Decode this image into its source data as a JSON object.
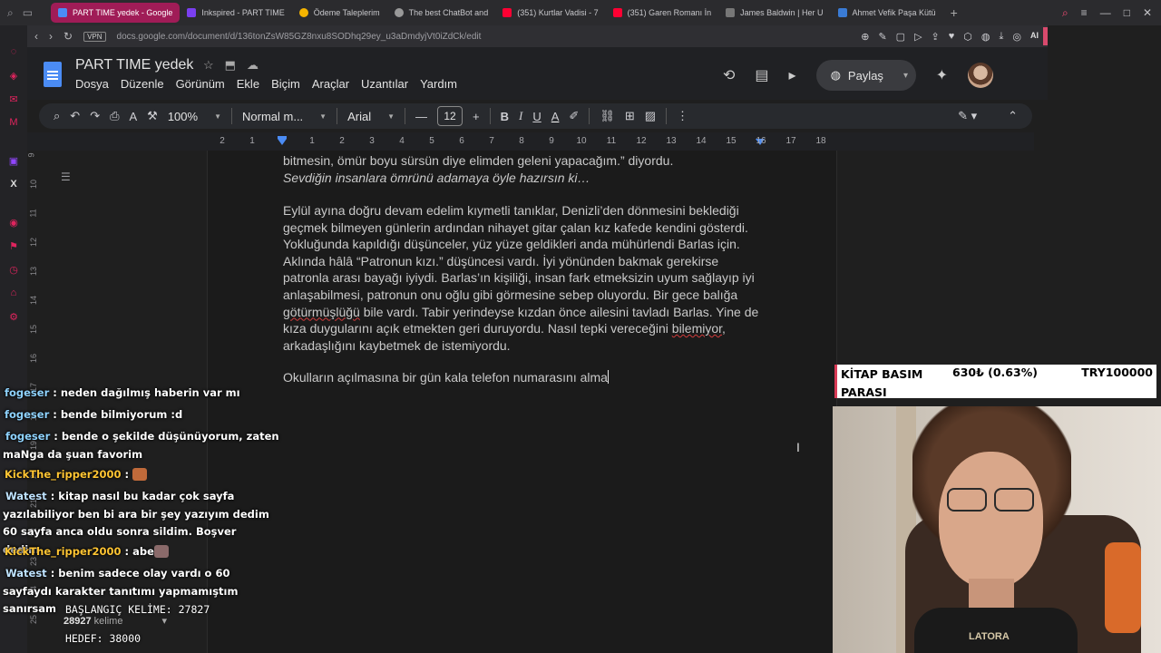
{
  "browser": {
    "tabs": [
      {
        "label": "PART TIME yedek - Google",
        "color": "#4b8cf5",
        "active": true
      },
      {
        "label": "Inkspired - PART TIME",
        "color": "#7a3ff0",
        "active": false
      },
      {
        "label": "Ödeme Taleplerim",
        "color": "#f5b400",
        "active": false
      },
      {
        "label": "The best ChatBot and",
        "color": "#999999",
        "active": false
      },
      {
        "label": "(351) Kurtlar Vadisi - 7",
        "color": "#ff0033",
        "active": false
      },
      {
        "label": "(351) Garen Romanı İn",
        "color": "#ff0033",
        "active": false
      },
      {
        "label": "James Baldwin | Her U",
        "color": "#777777",
        "active": false
      },
      {
        "label": "Ahmet Vefik Paşa Kütü",
        "color": "#3a7bd5",
        "active": false
      }
    ],
    "vpn_label": "VPN",
    "url": "docs.google.com/document/d/136tonZsW85GZ8nxu8SODhq29ey_u3aDmdyjVt0iZdCk/edit",
    "ai_label": "AI"
  },
  "docs": {
    "title": "PART TIME  yedek",
    "menu": [
      "Dosya",
      "Düzenle",
      "Görünüm",
      "Ekle",
      "Biçim",
      "Araçlar",
      "Uzantılar",
      "Yardım"
    ],
    "share_label": "Paylaş",
    "toolbar": {
      "zoom": "100%",
      "style": "Normal m...",
      "font": "Arial",
      "font_size": "12"
    },
    "ruler_ticks": [
      "2",
      "1",
      "1",
      "2",
      "3",
      "4",
      "5",
      "6",
      "7",
      "8",
      "9",
      "10",
      "11",
      "12",
      "13",
      "14",
      "15",
      "16",
      "17",
      "18"
    ],
    "vruler_ticks": [
      "9",
      "10",
      "11",
      "12",
      "13",
      "14",
      "15",
      "16",
      "17",
      "18",
      "19",
      "20",
      "21",
      "22",
      "23",
      "24",
      "25"
    ],
    "body": {
      "p1_line1": "bitmesin, ömür boyu sürsün diye elimden geleni yapacağım.” diyordu.",
      "p1_line2": "Sevdiğin insanlara ömrünü adamaya öyle hazırsın ki…",
      "p2": [
        "Eylül ayına doğru devam edelim kıymetli tanıklar, Denizli’den dönmesini beklediği",
        "geçmek bilmeyen günlerin ardından nihayet gitar çalan kız kafede kendini gösterdi.",
        "Yokluğunda kapıldığı düşünceler, yüz yüze geldikleri anda mühürlendi Barlas için.",
        "Aklında hâlâ “Patronun kızı.” düşüncesi vardı. İyi yönünden bakmak gerekirse",
        "patronla arası bayağı iyiydi. Barlas’ın kişiliği, insan fark etmeksizin uyum sağlayıp iyi",
        "anlaşabilmesi, patronun onu oğlu gibi görmesine sebep oluyordu. Bir gece balığa"
      ],
      "p2_l7_word": "götürmüşlüğü",
      "p2_l7_rest": " bile vardı. Tabir yerindeyse kızdan önce ailesini tavladı Barlas. Yine de",
      "p2_l8_start": "kıza duygularını açık etmekten geri duruyordu. Nasıl tepki vereceğini ",
      "p2_l8_word": "bilemiyor",
      "p2_l8_end": ",",
      "p2_l9": "arkadaşlığını kaybetmek de istemiyordu.",
      "p3": "Okulların açılmasına bir gün kala telefon numarasını alma"
    },
    "word_count": "28927",
    "word_count_label": "kelime"
  },
  "chat": [
    {
      "user": "fogeser",
      "text": " : neden dağılmış haberin var mı",
      "kind": "fog"
    },
    {
      "user": "fogeser",
      "text": " : bende bilmiyorum :d",
      "kind": "fog"
    },
    {
      "user": "fogeser",
      "text": " : bende o şekilde düşünüyorum, zaten maNga da şuan favorim",
      "kind": "fog"
    },
    {
      "user": "KickThe_ripper2000",
      "text": " : ",
      "kind": "kick",
      "emote": "#c06a3a"
    },
    {
      "user": "Watest",
      "text": " : kitap nasıl bu kadar çok sayfa yazılabiliyor ben bi ara bir şey yazıyım dedim 60 sayfa anca oldu sonra sildim. Boşver dedim",
      "kind": "wat"
    },
    {
      "user": "KickThe_ripper2000",
      "text": " : abe",
      "kind": "kick",
      "emote": "#8a6a6a"
    },
    {
      "user": "Watest",
      "text": " : benim sadece olay vardı o 60 sayfaydı karakter tanıtımı yapmamıştım sanırsam",
      "kind": "wat"
    }
  ],
  "stats": {
    "start_line": "BAŞLANGIÇ KELİME: 27827",
    "target_line": "HEDEF: 38000"
  },
  "ticker": {
    "label": "KİTAP BASIM PARASI",
    "price": "630₺ (0.63%)",
    "target": "TRY100000"
  },
  "webcam": {
    "shirt_text": "LATORA"
  }
}
